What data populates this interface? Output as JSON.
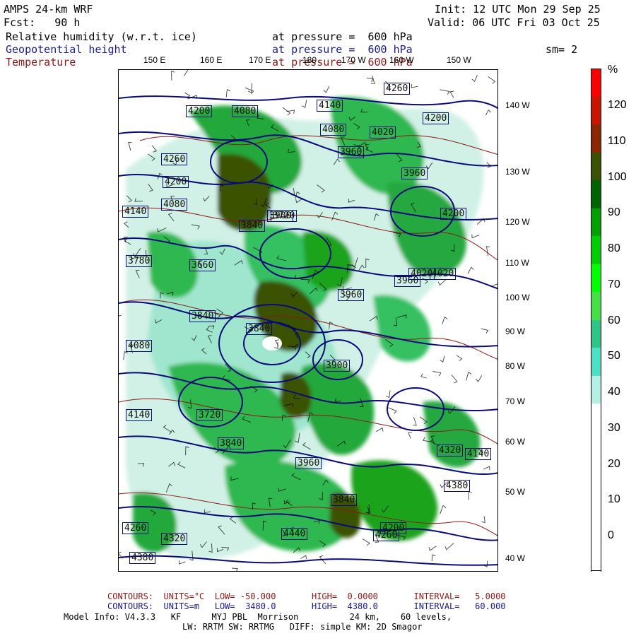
{
  "header": {
    "model": "AMPS 24-km WRF",
    "init": "Init: 12 UTC Mon 29 Sep 25",
    "fcst": "Fcst:   90 h",
    "valid": "Valid: 06 UTC Fri 03 Oct 25",
    "var1_name": "Relative humidity (w.r.t. ice)",
    "var1_press": "at pressure =  600 hPa",
    "var2_name": "Geopotential height",
    "var2_press": "at pressure =  600 hPa",
    "var3_name": "Temperature",
    "var3_press": "at pressure =  600 hPa",
    "smooth": "sm= 2"
  },
  "map": {
    "top_lon_labels": [
      "150 E",
      "160 E",
      "170 E",
      "180",
      "170 W",
      "160 W",
      "150 W"
    ],
    "right_lon_labels": [
      "140 W",
      "130 W",
      "120 W",
      "110 W",
      "100 W",
      "90 W",
      "80 W",
      "70 W",
      "60 W",
      "50 W",
      "40 W"
    ],
    "height_labels": [
      "4260",
      "4200",
      "4080",
      "4140",
      "4200",
      "4020",
      "4080",
      "3960",
      "4260",
      "4200",
      "3960",
      "4140",
      "4080",
      "3840",
      "3720",
      "3900",
      "3660",
      "3840",
      "3960",
      "4020",
      "3840",
      "3780",
      "4200",
      "4080",
      "4140",
      "4260",
      "4320",
      "4380",
      "4020",
      "3960",
      "3900",
      "3840",
      "3720",
      "3960",
      "4140",
      "4260",
      "4200",
      "3840",
      "4320",
      "4380",
      "4440"
    ],
    "colors": {
      "background": "#ffffff",
      "rh_30": "#d9f5ea",
      "rh_40": "#5ad9b3",
      "rh_60": "#2eb84f",
      "rh_80": "#1fa31f",
      "rh_100": "#3b5200",
      "height_contour": "#0a0a78",
      "temperature_contour": "#8b1a1a"
    }
  },
  "colorbar": {
    "unit": "%",
    "labels": [
      "120",
      "110",
      "100",
      "90",
      "80",
      "70",
      "60",
      "50",
      "40",
      "30",
      "20",
      "10",
      "0"
    ],
    "colors": [
      "#ff0000",
      "#c81400",
      "#8c2800",
      "#3b5200",
      "#006400",
      "#00a000",
      "#00cc00",
      "#00ff00",
      "#46e046",
      "#2ec48a",
      "#4de0c4",
      "#b4f0e4",
      "#ffffff",
      "#ffffff",
      "#ffffff",
      "#ffffff",
      "#ffffff",
      "#ffffff"
    ]
  },
  "footer": {
    "line1": "CONTOURS:  UNITS=°C  LOW= -50.000       HIGH=  0.0000       INTERVAL=   5.0000",
    "line2": "CONTOURS:  UNITS=m   LOW=  3480.0       HIGH=  4380.0       INTERVAL=   60.000",
    "line3": "Model Info: V4.3.3   KF      MYJ PBL  Morrison          24 km,    60 levels,",
    "line4": "LW: RRTM SW: RRTMG   DIFF: simple KM: 2D Smagor"
  }
}
